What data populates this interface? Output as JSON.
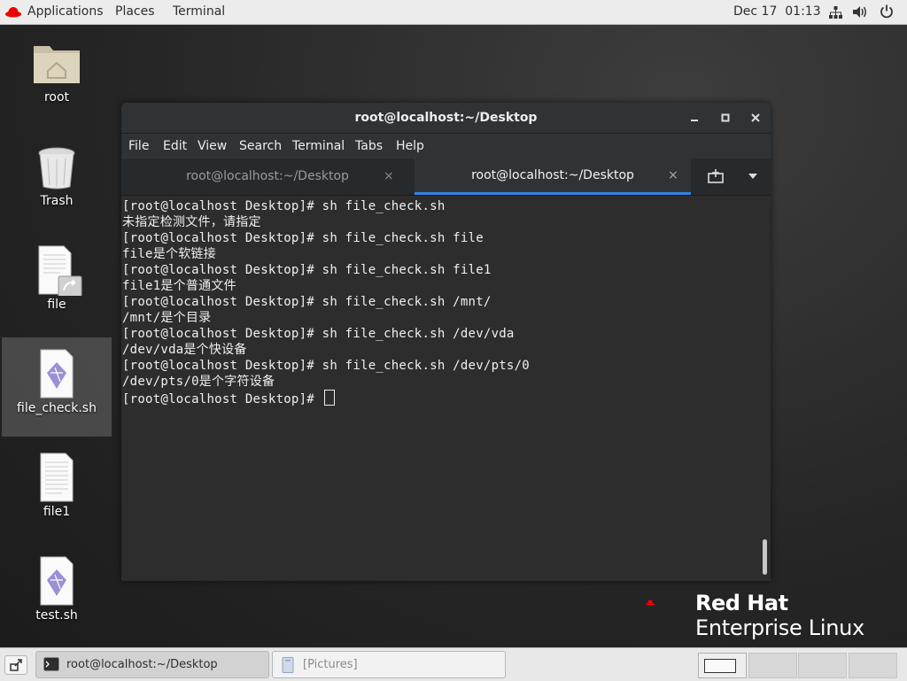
{
  "topbar": {
    "applications_label": "Applications",
    "places_label": "Places",
    "terminal_label": "Terminal",
    "clock": "Dec 17  01:13",
    "icons": [
      "network-icon",
      "volume-icon",
      "power-icon"
    ]
  },
  "desktop": {
    "icons": [
      {
        "label": "root",
        "icon": "folder-home-icon"
      },
      {
        "label": "Trash",
        "icon": "trash-icon"
      },
      {
        "label": "file",
        "icon": "symlink-document-icon"
      },
      {
        "label": "file_check.sh",
        "icon": "shell-script-icon",
        "selected": true
      },
      {
        "label": "file1",
        "icon": "text-document-icon"
      },
      {
        "label": "test.sh",
        "icon": "shell-script-icon"
      }
    ]
  },
  "terminal": {
    "title": "root@localhost:~/Desktop",
    "menu": [
      "File",
      "Edit",
      "View",
      "Search",
      "Terminal",
      "Tabs",
      "Help"
    ],
    "tabs": [
      {
        "label": "root@localhost:~/Desktop",
        "active": false
      },
      {
        "label": "root@localhost:~/Desktop",
        "active": true
      }
    ],
    "tab_close": "×",
    "lines": [
      "[root@localhost Desktop]# sh file_check.sh",
      "未指定检测文件，请指定",
      "[root@localhost Desktop]# sh file_check.sh file",
      "file是个软链接",
      "[root@localhost Desktop]# sh file_check.sh file1",
      "file1是个普通文件",
      "[root@localhost Desktop]# sh file_check.sh /mnt/",
      "/mnt/是个目录",
      "[root@localhost Desktop]# sh file_check.sh /dev/vda",
      "/dev/vda是个快设备",
      "[root@localhost Desktop]# sh file_check.sh /dev/pts/0",
      "/dev/pts/0是个字符设备",
      "[root@localhost Desktop]# "
    ]
  },
  "branding": {
    "line1": "Red Hat",
    "line2": "Enterprise Linux",
    "accent": "#ee0000"
  },
  "taskbar": {
    "tasks": [
      {
        "label": "root@localhost:~/Desktop",
        "icon": "terminal-icon"
      },
      {
        "label": "[Pictures]",
        "icon": "file-manager-icon"
      }
    ],
    "workspaces": 4,
    "active_workspace": 1
  }
}
